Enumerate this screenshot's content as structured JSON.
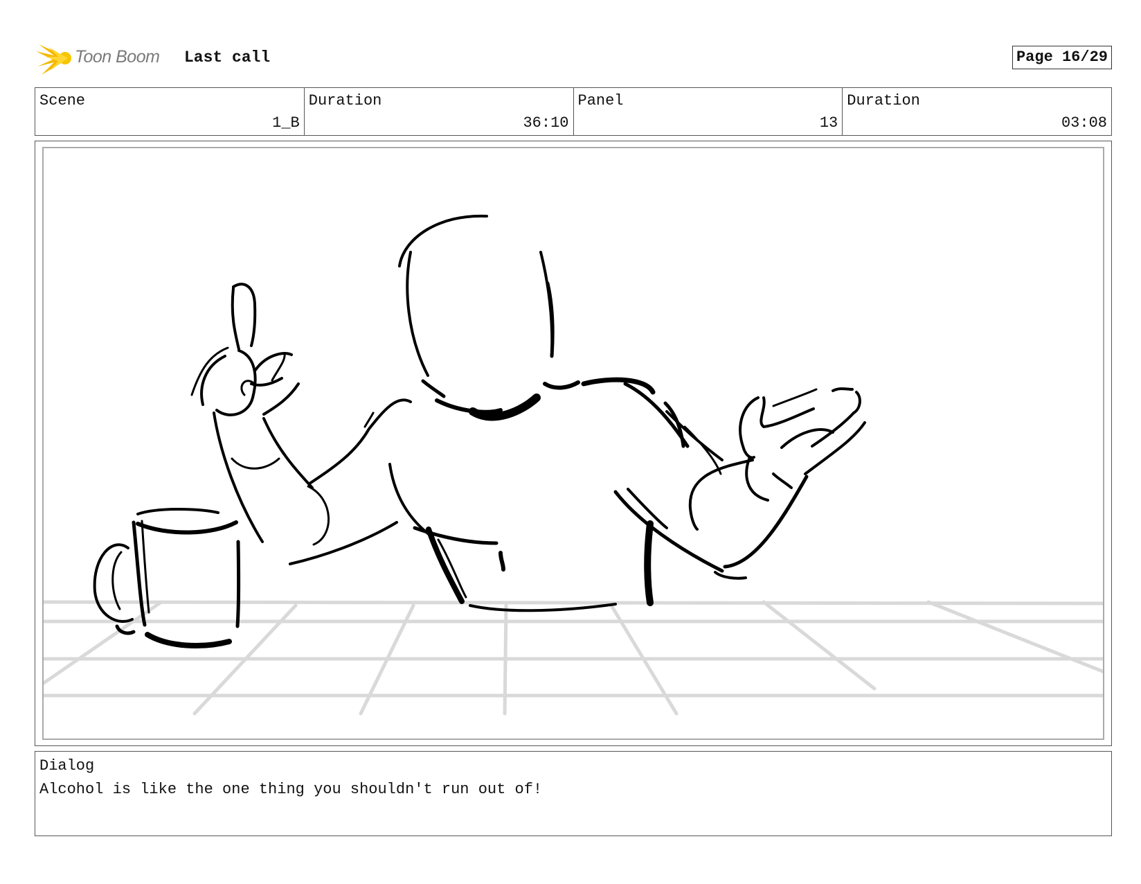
{
  "header": {
    "logo_text": "Toon Boom",
    "project_title": "Last call",
    "page_indicator": "Page 16/29"
  },
  "info": {
    "scene_label": "Scene",
    "scene_value": "1_B",
    "scene_duration_label": "Duration",
    "scene_duration_value": "36:10",
    "panel_label": "Panel",
    "panel_value": "13",
    "panel_duration_label": "Duration",
    "panel_duration_value": "03:08"
  },
  "dialog": {
    "label": "Dialog",
    "text": "Alcohol is like the one thing you shouldn't run out of!"
  },
  "colors": {
    "logo_yellow": "#f5b800",
    "ink": "#000000",
    "grid": "#d9d9d9"
  }
}
